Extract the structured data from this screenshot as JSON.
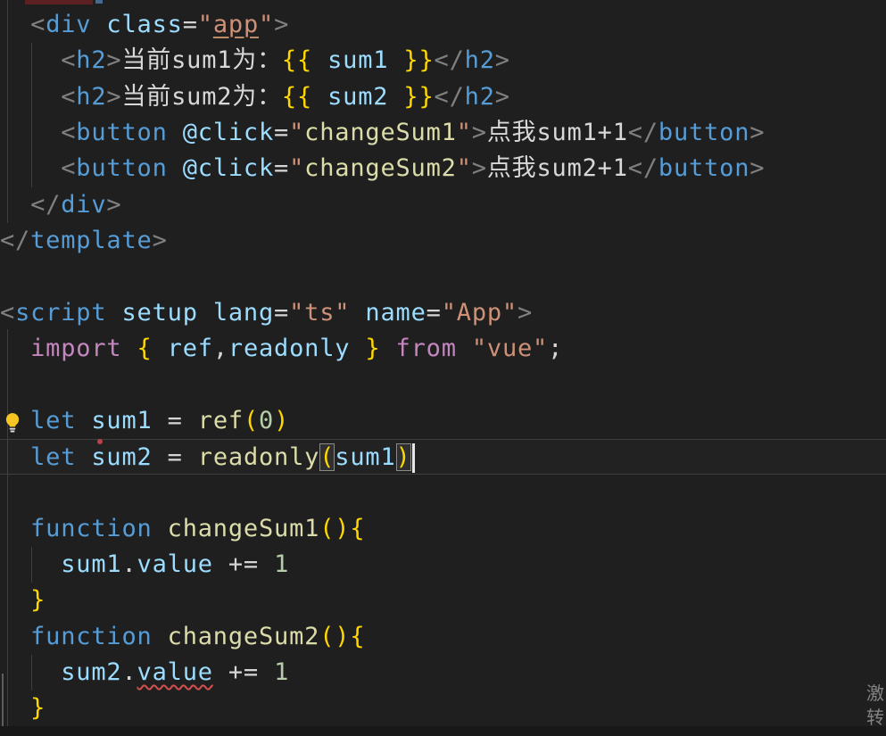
{
  "editor": {
    "language": "vue-sfc-typescript",
    "palette": {
      "background": "#1f1f1f",
      "tag": "#569cd6",
      "attribute": "#9cdcfe",
      "string": "#ce9178",
      "keyword": "#569cd6",
      "import_keyword": "#c586c0",
      "function_name": "#dcdcaa",
      "variable": "#9cdcfe",
      "number": "#b5cea8",
      "bracket_gold": "#ffd700",
      "punctuation": "#808080",
      "plain_text": "#d8d8d8",
      "error_squiggle": "#d14f4f"
    },
    "lines": [
      {
        "tokens": [
          [
            "  ",
            ""
          ],
          [
            "<",
            "p"
          ],
          [
            "div",
            "t"
          ],
          [
            " ",
            ""
          ],
          [
            "class",
            "a"
          ],
          [
            "=",
            "o"
          ],
          [
            "\"",
            "s"
          ],
          [
            "app",
            "su"
          ],
          [
            "\"",
            "s"
          ],
          [
            ">",
            "p"
          ]
        ]
      },
      {
        "tokens": [
          [
            "    ",
            ""
          ],
          [
            "<",
            "p"
          ],
          [
            "h2",
            "t"
          ],
          [
            ">",
            "p"
          ],
          [
            "当前sum1为：",
            "w"
          ],
          [
            "{{",
            "g"
          ],
          [
            " ",
            ""
          ],
          [
            "sum1",
            "v"
          ],
          [
            " ",
            ""
          ],
          [
            "}}",
            "g"
          ],
          [
            "</",
            "p"
          ],
          [
            "h2",
            "t"
          ],
          [
            ">",
            "p"
          ]
        ]
      },
      {
        "tokens": [
          [
            "    ",
            ""
          ],
          [
            "<",
            "p"
          ],
          [
            "h2",
            "t"
          ],
          [
            ">",
            "p"
          ],
          [
            "当前sum2为：",
            "w"
          ],
          [
            "{{",
            "g"
          ],
          [
            " ",
            ""
          ],
          [
            "sum2",
            "v"
          ],
          [
            " ",
            ""
          ],
          [
            "}}",
            "g"
          ],
          [
            "</",
            "p"
          ],
          [
            "h2",
            "t"
          ],
          [
            ">",
            "p"
          ]
        ]
      },
      {
        "tokens": [
          [
            "    ",
            ""
          ],
          [
            "<",
            "p"
          ],
          [
            "button",
            "t"
          ],
          [
            " ",
            ""
          ],
          [
            "@click",
            "a"
          ],
          [
            "=",
            "o"
          ],
          [
            "\"",
            "s"
          ],
          [
            "changeSum1",
            "f"
          ],
          [
            "\"",
            "s"
          ],
          [
            ">",
            "p"
          ],
          [
            "点我sum1+1",
            "w"
          ],
          [
            "</",
            "p"
          ],
          [
            "button",
            "t"
          ],
          [
            ">",
            "p"
          ]
        ]
      },
      {
        "tokens": [
          [
            "    ",
            ""
          ],
          [
            "<",
            "p"
          ],
          [
            "button",
            "t"
          ],
          [
            " ",
            ""
          ],
          [
            "@click",
            "a"
          ],
          [
            "=",
            "o"
          ],
          [
            "\"",
            "s"
          ],
          [
            "changeSum2",
            "f"
          ],
          [
            "\"",
            "s"
          ],
          [
            ">",
            "p"
          ],
          [
            "点我sum2+1",
            "w"
          ],
          [
            "</",
            "p"
          ],
          [
            "button",
            "t"
          ],
          [
            ">",
            "p"
          ]
        ]
      },
      {
        "tokens": [
          [
            "  ",
            ""
          ],
          [
            "</",
            "p"
          ],
          [
            "div",
            "t"
          ],
          [
            ">",
            "p"
          ]
        ]
      },
      {
        "tokens": [
          [
            "</",
            "p"
          ],
          [
            "template",
            "t"
          ],
          [
            ">",
            "p"
          ]
        ]
      },
      {
        "tokens": []
      },
      {
        "tokens": [
          [
            "<",
            "p"
          ],
          [
            "script",
            "t"
          ],
          [
            " ",
            ""
          ],
          [
            "setup",
            "a"
          ],
          [
            " ",
            ""
          ],
          [
            "lang",
            "a"
          ],
          [
            "=",
            "o"
          ],
          [
            "\"ts\"",
            "s"
          ],
          [
            " ",
            ""
          ],
          [
            "name",
            "a"
          ],
          [
            "=",
            "o"
          ],
          [
            "\"App\"",
            "s"
          ],
          [
            ">",
            "p"
          ]
        ]
      },
      {
        "tokens": [
          [
            "  ",
            ""
          ],
          [
            "import",
            "i"
          ],
          [
            " ",
            ""
          ],
          [
            "{",
            "g"
          ],
          [
            " ",
            ""
          ],
          [
            "ref",
            "v"
          ],
          [
            ",",
            "o"
          ],
          [
            "readonly",
            "v"
          ],
          [
            " ",
            ""
          ],
          [
            "}",
            "g"
          ],
          [
            " ",
            ""
          ],
          [
            "from",
            "i"
          ],
          [
            " ",
            ""
          ],
          [
            "\"vue\"",
            "s"
          ],
          [
            ";",
            "o"
          ]
        ]
      },
      {
        "tokens": []
      },
      {
        "lightbulb": true,
        "tokens": [
          [
            "  ",
            ""
          ],
          [
            "let",
            "k"
          ],
          [
            " ",
            ""
          ],
          [
            "sum1",
            "v"
          ],
          [
            " ",
            ""
          ],
          [
            "=",
            "o"
          ],
          [
            " ",
            ""
          ],
          [
            "ref",
            "f"
          ],
          [
            "(",
            "g"
          ],
          [
            "0",
            "n"
          ],
          [
            ")",
            "g"
          ]
        ]
      },
      {
        "current": true,
        "tokens": [
          [
            "  ",
            ""
          ],
          [
            "let",
            "k"
          ],
          [
            " ",
            ""
          ],
          [
            "sum2",
            "v rd"
          ],
          [
            " ",
            ""
          ],
          [
            "=",
            "o"
          ],
          [
            " ",
            ""
          ],
          [
            "readonly",
            "f"
          ],
          [
            "(",
            "g bb"
          ],
          [
            "sum1",
            "v"
          ],
          [
            ")",
            "g bb"
          ],
          [
            "",
            "cur"
          ]
        ]
      },
      {
        "tokens": []
      },
      {
        "tokens": [
          [
            "  ",
            ""
          ],
          [
            "function",
            "k"
          ],
          [
            " ",
            ""
          ],
          [
            "changeSum1",
            "f"
          ],
          [
            "(",
            "g"
          ],
          [
            ")",
            "g"
          ],
          [
            "{",
            "g"
          ]
        ]
      },
      {
        "tokens": [
          [
            "    ",
            ""
          ],
          [
            "sum1",
            "v"
          ],
          [
            ".",
            "o"
          ],
          [
            "value",
            "v"
          ],
          [
            " ",
            ""
          ],
          [
            "+=",
            "o"
          ],
          [
            " ",
            ""
          ],
          [
            "1",
            "n"
          ]
        ]
      },
      {
        "tokens": [
          [
            "  ",
            ""
          ],
          [
            "}",
            "g"
          ]
        ]
      },
      {
        "tokens": [
          [
            "  ",
            ""
          ],
          [
            "function",
            "k"
          ],
          [
            " ",
            ""
          ],
          [
            "changeSum2",
            "f"
          ],
          [
            "(",
            "g"
          ],
          [
            ")",
            "g"
          ],
          [
            "{",
            "g"
          ]
        ]
      },
      {
        "tokens": [
          [
            "    ",
            ""
          ],
          [
            "sum2",
            "v"
          ],
          [
            ".",
            "o"
          ],
          [
            "value",
            "v sq"
          ],
          [
            " ",
            ""
          ],
          [
            "+=",
            "o"
          ],
          [
            " ",
            ""
          ],
          [
            "1",
            "n"
          ]
        ]
      },
      {
        "tokens": [
          [
            "  ",
            ""
          ],
          [
            "}",
            "g"
          ]
        ]
      }
    ]
  },
  "watermark": {
    "char1": "激",
    "char2": "转"
  }
}
